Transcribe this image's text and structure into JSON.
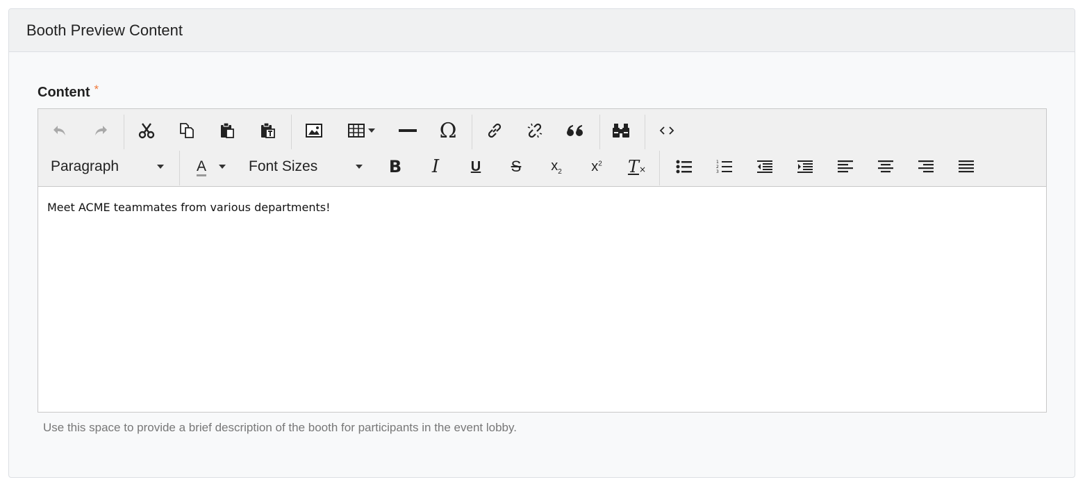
{
  "panel": {
    "title": "Booth Preview Content"
  },
  "field": {
    "label": "Content",
    "required_marker": "*",
    "help_text": "Use this space to provide a brief description of the booth for participants in the event lobby."
  },
  "toolbar": {
    "row1": [
      "undo-icon",
      "redo-icon",
      "cut-icon",
      "copy-icon",
      "paste-icon",
      "paste-text-icon",
      "image-icon",
      "table-icon",
      "horizontal-rule-icon",
      "special-character-icon",
      "link-icon",
      "unlink-icon",
      "blockquote-icon",
      "find-replace-icon",
      "source-code-icon"
    ],
    "block_format": "Paragraph",
    "text_color_label": "A",
    "font_sizes": "Font Sizes",
    "accent_underline_color": "#999999"
  },
  "editor": {
    "content": "Meet ACME teammates from various departments!"
  },
  "colors": {
    "required": "#f0793a",
    "disabled": "#a9a9a9"
  }
}
